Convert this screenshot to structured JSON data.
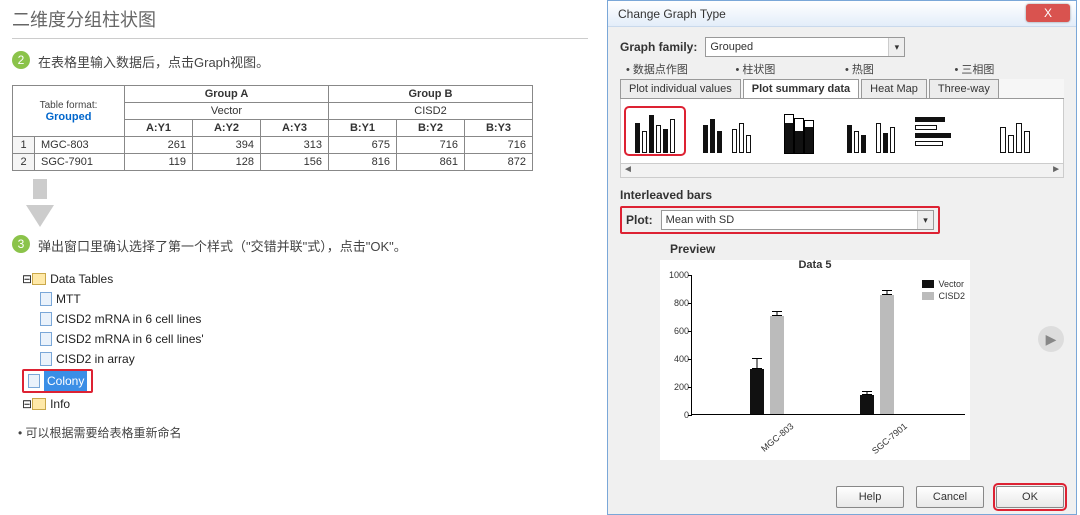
{
  "left": {
    "title": "二维度分组柱状图",
    "step2_num": "2",
    "step2_text": "在表格里输入数据后，点击Graph视图。",
    "step3_num": "3",
    "step3_text": "弹出窗口里确认选择了第一个样式（\"交错并联\"式），点击\"OK\"。",
    "note_bullet": "•",
    "note": "可以根据需要给表格重新命名",
    "table": {
      "format_label": "Table format:",
      "format_value": "Grouped",
      "groupA": "Group A",
      "groupB": "Group B",
      "subA": "Vector",
      "subB": "CISD2",
      "cols": {
        "a1": "A:Y1",
        "a2": "A:Y2",
        "a3": "A:Y3",
        "b1": "B:Y1",
        "b2": "B:Y2",
        "b3": "B:Y3"
      },
      "r1": {
        "n": "1",
        "name": "MGC-803",
        "a1": "261",
        "a2": "394",
        "a3": "313",
        "b1": "675",
        "b2": "716",
        "b3": "716"
      },
      "r2": {
        "n": "2",
        "name": "SGC-7901",
        "a1": "119",
        "a2": "128",
        "a3": "156",
        "b1": "816",
        "b2": "861",
        "b3": "872"
      }
    },
    "tree": {
      "root": "Data Tables",
      "n1": "MTT",
      "n2": "CISD2 mRNA in 6 cell lines",
      "n3": "CISD2 mRNA in 6 cell lines'",
      "n4": "CISD2 in array",
      "n5": "Colony",
      "n6": "Info"
    }
  },
  "dialog": {
    "title": "Change Graph Type",
    "close": "X",
    "family_label": "Graph family:",
    "family_value": "Grouped",
    "cn": {
      "c1": "• 数据点作图",
      "c2": "• 柱状图",
      "c3": "• 热图",
      "c4": "• 三相图"
    },
    "tabs": {
      "t1": "Plot individual values",
      "t2": "Plot summary data",
      "t3": "Heat Map",
      "t4": "Three-way"
    },
    "section_header": "Interleaved bars",
    "plot_label": "Plot:",
    "plot_value": "Mean with SD",
    "preview_label": "Preview",
    "buttons": {
      "help": "Help",
      "cancel": "Cancel",
      "ok": "OK"
    }
  },
  "chart_data": {
    "type": "bar",
    "title": "Data 5",
    "ylabel": "",
    "ylim": [
      0,
      1000
    ],
    "yticks": [
      0,
      200,
      400,
      600,
      800,
      1000
    ],
    "categories": [
      "MGC-803",
      "SGC-7901"
    ],
    "series": [
      {
        "name": "Vector",
        "color": "#111",
        "values": [
          323,
          134
        ],
        "sd": [
          67,
          20
        ]
      },
      {
        "name": "CISD2",
        "color": "#bbb",
        "values": [
          702,
          850
        ],
        "sd": [
          24,
          30
        ]
      }
    ]
  }
}
